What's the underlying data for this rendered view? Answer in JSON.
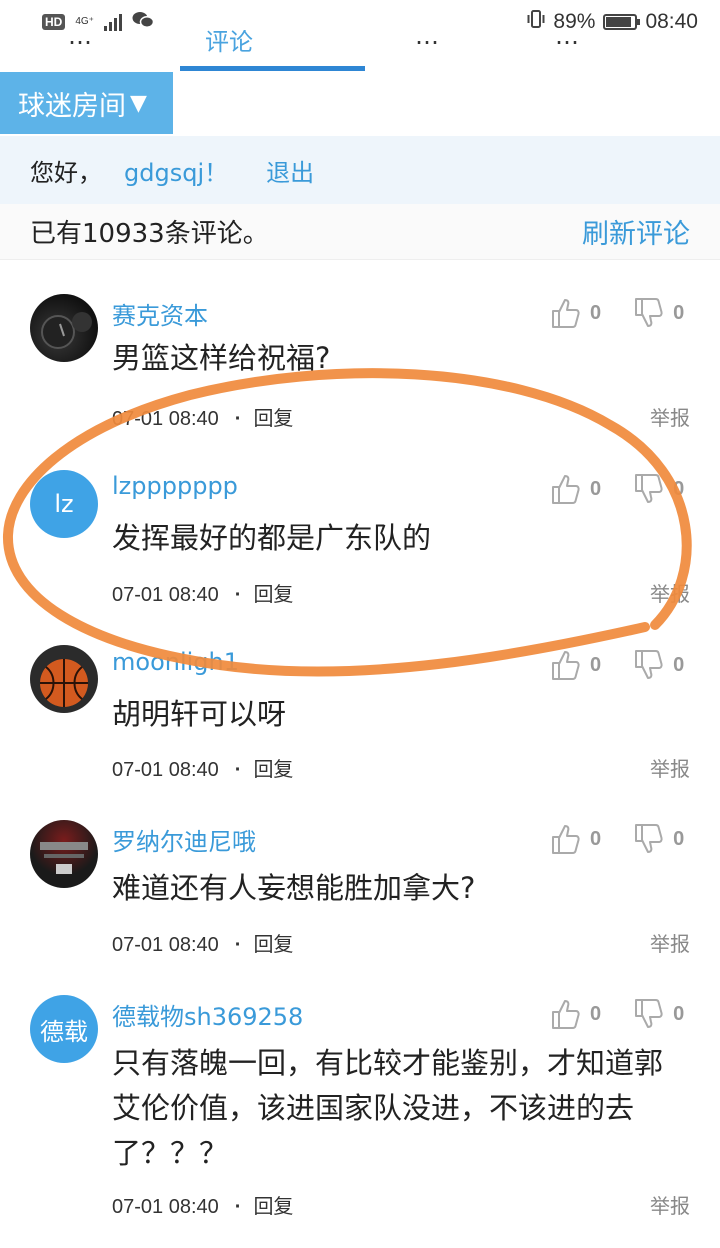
{
  "status_bar": {
    "hd": "HD",
    "network": "4G⁺",
    "battery_text": "89%",
    "battery_level": 0.89,
    "time": "08:40"
  },
  "tabs": [
    {
      "label": "…"
    },
    {
      "label": "评论"
    },
    {
      "label": "…"
    },
    {
      "label": "…"
    }
  ],
  "room": {
    "label": "球迷房间",
    "caret": "▼"
  },
  "greeting": {
    "prefix": "您好，",
    "username": "gdgsqj！",
    "logout": "退出"
  },
  "comment_bar": {
    "count_text": "已有10933条评论。",
    "refresh": "刷新评论"
  },
  "reply_label": "回复",
  "report_label": "举报",
  "comments": [
    {
      "user": "赛克资本",
      "text": "男篮这样给祝福?",
      "time": "07-01 08:40",
      "likes": "0",
      "dislikes": "0",
      "avatar_text": ""
    },
    {
      "user": "lzppppppp",
      "text": "发挥最好的都是广东队的",
      "time": "07-01 08:40",
      "likes": "0",
      "dislikes": "0",
      "avatar_text": "lz"
    },
    {
      "user": "moonligh1",
      "text": "胡明轩可以呀",
      "time": "07-01 08:40",
      "likes": "0",
      "dislikes": "0",
      "avatar_text": ""
    },
    {
      "user": "罗纳尔迪尼哦",
      "text": "难道还有人妄想能胜加拿大?",
      "time": "07-01 08:40",
      "likes": "0",
      "dislikes": "0",
      "avatar_text": ""
    },
    {
      "user": "德载物sh369258",
      "text": "只有落魄一回，有比较才能鉴别，才知道郭艾伦价值，该进国家队没进，不该进的去了？？？",
      "time": "07-01 08:40",
      "likes": "0",
      "dislikes": "0",
      "avatar_text": "德载"
    }
  ],
  "colors": {
    "accent": "#3a9ad9",
    "room_bg": "#5db3e8",
    "highlight": "#f08a3c"
  }
}
